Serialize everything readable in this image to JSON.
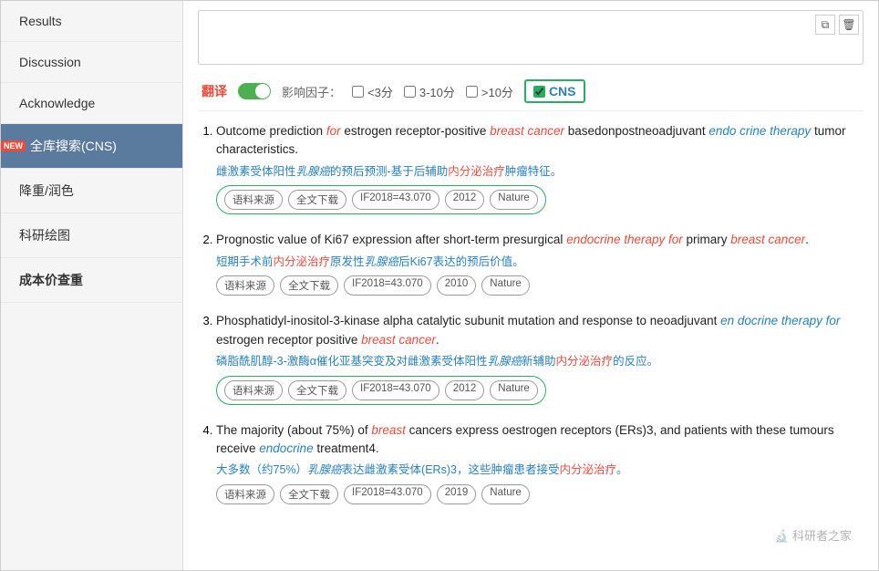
{
  "sidebar": {
    "items": [
      {
        "label": "Results",
        "active": false,
        "badge": false
      },
      {
        "label": "Discussion",
        "active": false,
        "badge": false
      },
      {
        "label": "Acknowledge",
        "active": false,
        "badge": false
      },
      {
        "label": "全库搜索(CNS)",
        "active": true,
        "badge": true,
        "badge_text": "NEW"
      },
      {
        "label": "降重/润色",
        "active": false,
        "badge": false
      },
      {
        "label": "科研绘图",
        "active": false,
        "badge": false
      },
      {
        "label": "成本价查重",
        "active": false,
        "badge": false,
        "bold": true
      }
    ]
  },
  "filter": {
    "translate_label": "翻译",
    "impact_label": "影响因子：",
    "lt3_label": "<3分",
    "range_label": "3-10分",
    "gt10_label": ">10分",
    "cns_label": "CNS",
    "cns_checked": true
  },
  "results": [
    {
      "index": 1,
      "title_parts": [
        {
          "text": "Outcome prediction ",
          "style": "normal"
        },
        {
          "text": "for",
          "style": "italic-red"
        },
        {
          "text": " estrogen receptor-positive ",
          "style": "normal"
        },
        {
          "text": "breast cancer",
          "style": "italic-red"
        },
        {
          "text": " basedonpostneoadjuvant ",
          "style": "normal"
        },
        {
          "text": "endo crine therapy",
          "style": "italic-blue"
        },
        {
          "text": " tumor characteristics.",
          "style": "normal"
        }
      ],
      "translation": "雌激素受体阳性乳腺癌的预后预测-基于后辅助内分泌治疗肿瘤特征。",
      "tags": [
        "语料来源",
        "全文下载",
        "IF2018=43.070",
        "2012",
        "Nature"
      ],
      "tags_highlighted": true
    },
    {
      "index": 2,
      "title_parts": [
        {
          "text": "Prognostic value of Ki67 expression after short-term presurgical ",
          "style": "normal"
        },
        {
          "text": "endocrine therapy for",
          "style": "italic-red"
        },
        {
          "text": " primary ",
          "style": "normal"
        },
        {
          "text": "breast cancer",
          "style": "italic-red"
        },
        {
          "text": ".",
          "style": "normal"
        }
      ],
      "translation": "短期手术前内分泌治疗原发性乳腺癌后Ki67表达的预后价值。",
      "tags": [
        "语料来源",
        "全文下载",
        "IF2018=43.070",
        "2010",
        "Nature"
      ],
      "tags_highlighted": false
    },
    {
      "index": 3,
      "title_parts": [
        {
          "text": "Phosphatidyl-inositol-3-kinase alpha catalytic subunit mutation and response to neoadjuvant ",
          "style": "normal"
        },
        {
          "text": "en docrine therapy for",
          "style": "italic-blue"
        },
        {
          "text": " estrogen receptor positive ",
          "style": "normal"
        },
        {
          "text": "breast cancer",
          "style": "italic-red"
        },
        {
          "text": ".",
          "style": "normal"
        }
      ],
      "translation": "磷脂酰肌醇-3-激酶α催化亚基突变及对雌激素受体阳性乳腺癌新辅助内分泌治疗的反应。",
      "tags": [
        "语料来源",
        "全文下载",
        "IF2018=43.070",
        "2012",
        "Nature"
      ],
      "tags_highlighted": true
    },
    {
      "index": 4,
      "title_parts": [
        {
          "text": "The majority (about 75%) of ",
          "style": "normal"
        },
        {
          "text": "breast",
          "style": "italic-red"
        },
        {
          "text": " cancers express oestrogen receptors (ERs)3, and patients with these tumours receive ",
          "style": "normal"
        },
        {
          "text": "endocrine",
          "style": "italic-blue"
        },
        {
          "text": " treatment4.",
          "style": "normal"
        }
      ],
      "translation": "大多数（约75%）乳腺癌表达雌激素受体(ERs)3，这些肿瘤患者接受内分泌治疗。",
      "tags": [
        "语料来源",
        "全文下载",
        "IF2018=43.070",
        "2019",
        "Nature"
      ],
      "tags_highlighted": false
    }
  ],
  "watermark": {
    "icon": "🔬",
    "text": "科研者之家"
  }
}
